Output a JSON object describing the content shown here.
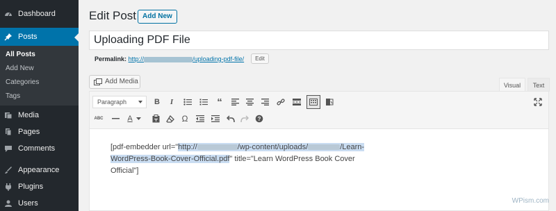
{
  "sidebar": {
    "items": [
      {
        "label": "Dashboard",
        "icon": "dashboard-icon"
      },
      {
        "label": "Posts",
        "icon": "pin-icon",
        "current": true
      },
      {
        "label": "Media",
        "icon": "media-icon"
      },
      {
        "label": "Pages",
        "icon": "pages-icon"
      },
      {
        "label": "Comments",
        "icon": "comments-icon"
      },
      {
        "label": "Appearance",
        "icon": "appearance-icon"
      },
      {
        "label": "Plugins",
        "icon": "plugins-icon"
      },
      {
        "label": "Users",
        "icon": "users-icon"
      }
    ],
    "submenu": [
      {
        "label": "All Posts",
        "current": true
      },
      {
        "label": "Add New"
      },
      {
        "label": "Categories"
      },
      {
        "label": "Tags"
      }
    ]
  },
  "page": {
    "title": "Edit Post",
    "add_new_label": "Add New"
  },
  "post": {
    "title": "Uploading PDF File",
    "permalink_label": "Permalink:",
    "permalink_prefix": "http://",
    "permalink_slug": "/uploading-pdf-file/",
    "edit_label": "Edit"
  },
  "editor": {
    "add_media_label": "Add Media",
    "tab_visual": "Visual",
    "tab_text": "Text",
    "format_select": "Paragraph",
    "content": {
      "prefix": "[pdf-embedder url=\"",
      "link_start": "http://",
      "link_mid": "/wp-content/uploads/",
      "link_line2": "/Learn-",
      "link_end": "WordPress-Book-Cover-Official.pdf",
      "after_link": "\" title=\"Learn WordPress Book Cover",
      "line3": "Official\"]"
    }
  },
  "toolbar_icons": [
    "bold-icon",
    "italic-icon",
    "bullet-list-icon",
    "numbered-list-icon",
    "blockquote-icon",
    "align-left-icon",
    "align-center-icon",
    "align-right-icon",
    "link-icon",
    "read-more-icon",
    "toolbar-toggle-icon",
    "pdf-embed-icon",
    "fullscreen-icon",
    "strikethrough-icon",
    "horizontal-line-icon",
    "text-color-icon",
    "paste-text-icon",
    "clear-formatting-icon",
    "special-character-icon",
    "outdent-icon",
    "indent-icon",
    "undo-icon",
    "redo-icon",
    "help-icon"
  ],
  "watermark": "WPism.com",
  "colors": {
    "sidebar": "#23282d",
    "accent": "#0073aa",
    "selection": "#c9dcf1"
  }
}
